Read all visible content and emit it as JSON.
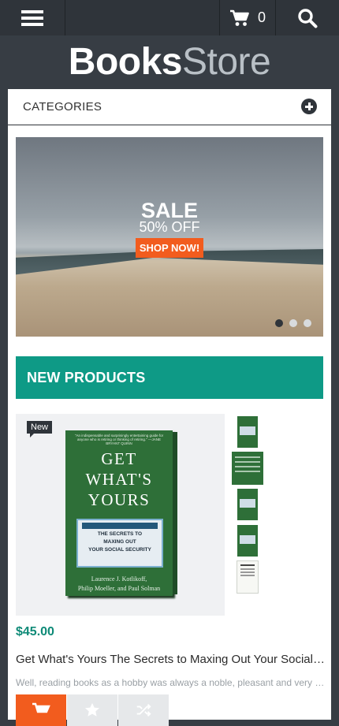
{
  "header": {
    "cart_count": "0",
    "icons": [
      "menu-icon",
      "cart-icon",
      "search-icon"
    ]
  },
  "logo": {
    "part1": "Books",
    "part2": "Store"
  },
  "categories": {
    "label": "CATEGORIES"
  },
  "banner": {
    "title": "SALE",
    "subtitle": "50% OFF",
    "button": "SHOP NOW!",
    "slides": 3,
    "active_slide": 1
  },
  "new_products": {
    "heading": "NEW PRODUCTS",
    "product": {
      "badge": "New",
      "price": "$45.00",
      "title": "Get What's Yours The Secrets to Maxing Out Your Social Security",
      "description": "Well, reading books as a hobby was always a noble, pleasant and very useful occupation.",
      "cover": {
        "quote": "\"An indispensable and surprisingly entertaining guide for anyone who is retiring or thinking of retiring.\" —JANE BRYANT QUINN",
        "title_lines": [
          "GET",
          "WHAT'S",
          "YOURS"
        ],
        "card_header": "SOCIAL SECURITY",
        "card_lines": [
          "THE SECRETS TO",
          "MAXING OUT",
          "YOUR SOCIAL SECURITY"
        ],
        "authors_line1": "Laurence J. Kotlikoff,",
        "authors_line2": "Philip Moeller, and Paul Solman"
      }
    }
  },
  "colors": {
    "background": "#373d44",
    "topbar": "#2f343a",
    "accent": "#0e9a86",
    "price": "#0e8a77",
    "button": "#f25c1e"
  }
}
